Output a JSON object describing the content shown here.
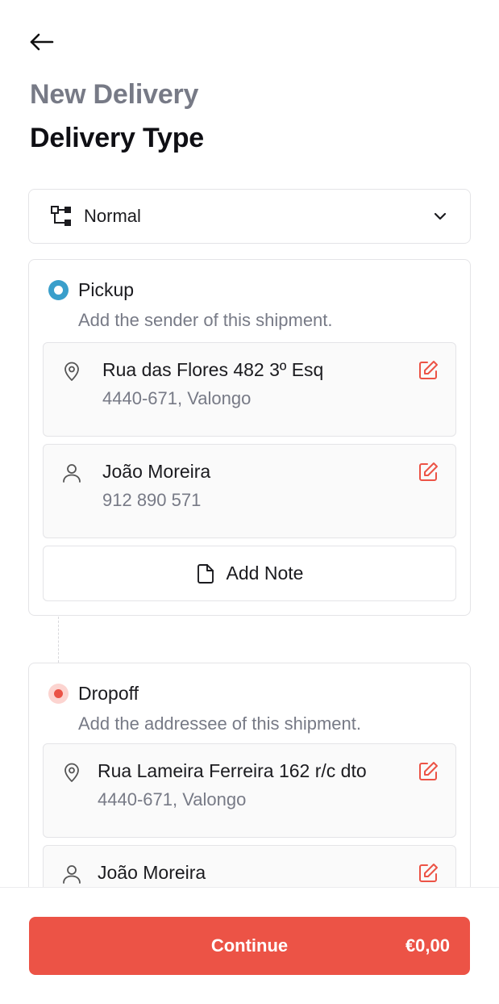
{
  "header": {
    "subtitle": "New Delivery",
    "title": "Delivery Type"
  },
  "delivery_type": {
    "selected": "Normal",
    "icon": "workflow-icon"
  },
  "pickup": {
    "title": "Pickup",
    "description": "Add the sender of this shipment.",
    "address": {
      "street": "Rua das Flores 482 3º Esq",
      "postal": "4440-671, Valongo"
    },
    "contact": {
      "name": "João Moreira",
      "phone": "912 890 571"
    },
    "add_note_label": "Add Note"
  },
  "dropoff": {
    "title": "Dropoff",
    "description": "Add the addressee of this shipment.",
    "address": {
      "street": "Rua Lameira Ferreira 162 r/c dto",
      "postal": "4440-671, Valongo"
    },
    "contact": {
      "name": "João Moreira"
    }
  },
  "footer": {
    "continue_label": "Continue",
    "price": "€0,00"
  },
  "colors": {
    "accent": "#ec5346",
    "pickup_dot": "#3a9fcb",
    "muted_text": "#777a86"
  }
}
